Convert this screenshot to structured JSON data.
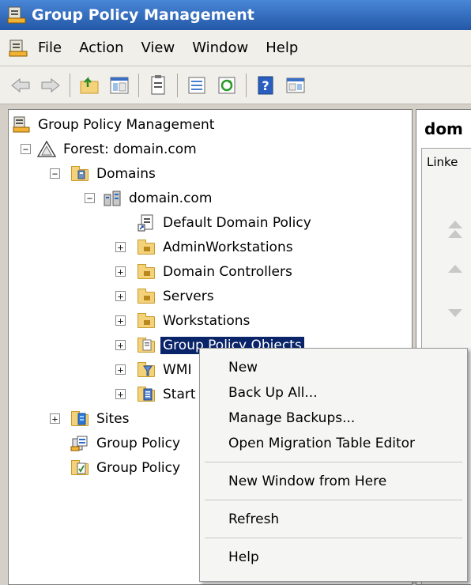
{
  "window": {
    "title": "Group Policy Management"
  },
  "menubar": {
    "items": [
      "File",
      "Action",
      "View",
      "Window",
      "Help"
    ]
  },
  "toolbar": {
    "buttons": [
      "back-icon",
      "forward-icon",
      "up-folder-icon",
      "show-hide-tree-icon",
      "properties-icon",
      "export-list-icon",
      "refresh-icon",
      "help-icon",
      "show-action-pane-icon"
    ]
  },
  "tree": {
    "root": "Group Policy Management",
    "forest": "Forest: domain.com",
    "domains": "Domains",
    "domain": "domain.com",
    "children": [
      "Default Domain Policy",
      "AdminWorkstations",
      "Domain Controllers",
      "Servers",
      "Workstations",
      "Group Policy Objects",
      "WMI",
      "Start"
    ],
    "sites": "Sites",
    "gp_modeling": "Group Policy",
    "gp_results": "Group Policy"
  },
  "right_pane": {
    "title": "dom",
    "tab": "Linke"
  },
  "context_menu": {
    "items": [
      "New",
      "Back Up All...",
      "Manage Backups...",
      "Open Migration Table Editor"
    ],
    "item_window": "New Window from Here",
    "item_refresh": "Refresh",
    "item_help": "Help"
  },
  "colors": {
    "selection": "#0a246a",
    "titlebar": "#2f6bbf",
    "folder": "#f4d27a"
  }
}
